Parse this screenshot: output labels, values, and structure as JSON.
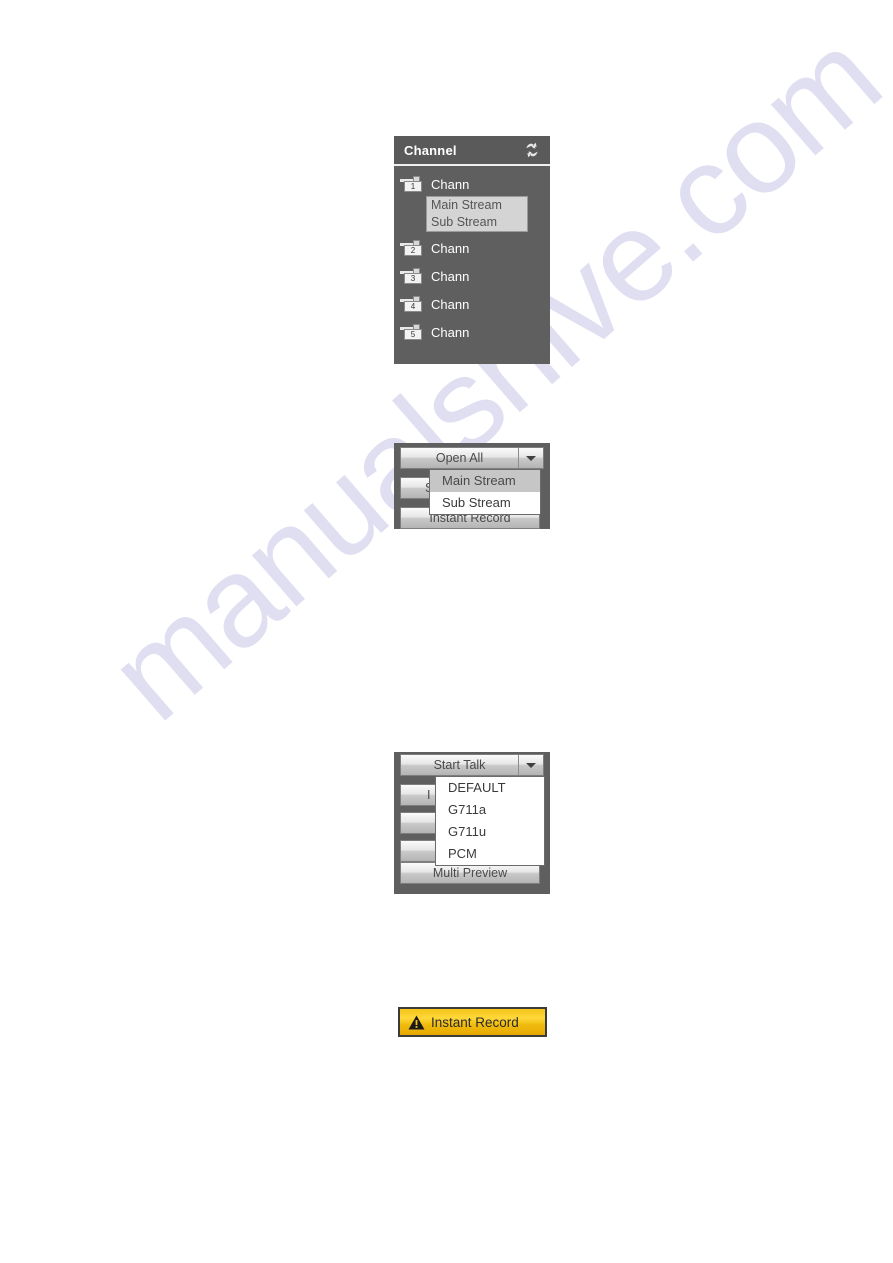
{
  "page": {
    "background": "#ffffff",
    "watermark": {
      "text": "manualshive.com",
      "color": "#ccccea"
    }
  },
  "channel_panel": {
    "title": "Channel",
    "refresh_icon": "refresh-icon",
    "accent": "#5f5f5f",
    "items": [
      {
        "num": "1",
        "label": "Chann",
        "icon": "camera-icon"
      },
      {
        "num": "2",
        "label": "Chann",
        "icon": "camera-icon"
      },
      {
        "num": "3",
        "label": "Chann",
        "icon": "camera-icon"
      },
      {
        "num": "4",
        "label": "Chann",
        "icon": "camera-icon"
      },
      {
        "num": "5",
        "label": "Chann",
        "icon": "camera-icon"
      }
    ],
    "stream_popup": {
      "options": [
        "Main Stream",
        "Sub Stream"
      ]
    }
  },
  "open_all_panel": {
    "button_label": "Open All",
    "caret_icon": "chevron-down-icon",
    "menu": {
      "options": [
        "Main Stream",
        "Sub Stream"
      ],
      "highlighted": "Main Stream"
    },
    "background_rows": [
      {
        "label": "S"
      },
      {
        "label": "Instant Record"
      }
    ]
  },
  "start_talk_panel": {
    "button_label": "Start Talk",
    "caret_icon": "chevron-down-icon",
    "menu": {
      "options": [
        "DEFAULT",
        "G711a",
        "G711u",
        "PCM"
      ]
    },
    "background_rows": [
      {
        "label": "I"
      },
      {
        "label": ""
      },
      {
        "label": ""
      },
      {
        "label": "Multi Preview"
      }
    ]
  },
  "instant_record_button": {
    "label": "Instant Record",
    "icon": "warning-triangle-icon",
    "fill": "#f5c518",
    "border": "#3b3b3b"
  }
}
